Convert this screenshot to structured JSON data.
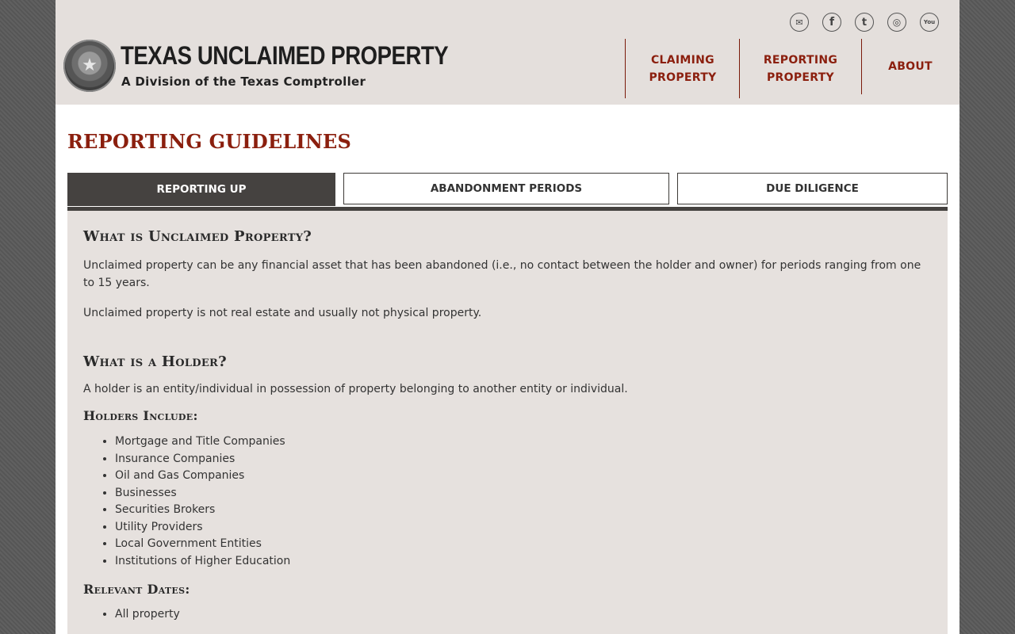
{
  "header": {
    "logo_title": "TEXAS UNCLAIMED PROPERTY",
    "logo_subtitle": "A Division of the Texas Comptroller",
    "social": [
      {
        "icon": "email-icon",
        "glyph": "✉"
      },
      {
        "icon": "facebook-icon",
        "glyph": "f"
      },
      {
        "icon": "twitter-icon",
        "glyph": "t"
      },
      {
        "icon": "instagram-icon",
        "glyph": "◎"
      },
      {
        "icon": "youtube-icon",
        "glyph": "You"
      }
    ],
    "nav": {
      "claiming_line1": "CLAIMING",
      "claiming_line2": "PROPERTY",
      "reporting_line1": "REPORTING",
      "reporting_line2": "PROPERTY",
      "about": "ABOUT"
    }
  },
  "main": {
    "title": "REPORTING GUIDELINES",
    "tabs": [
      {
        "label": "REPORTING UP",
        "active": true
      },
      {
        "label": "ABANDONMENT PERIODS",
        "active": false
      },
      {
        "label": "DUE DILIGENCE",
        "active": false
      }
    ],
    "section1": {
      "heading": "What is Unclaimed Property?",
      "para1": "Unclaimed property can be any financial asset that has been abandoned (i.e., no contact between the holder and owner) for periods ranging from one to 15 years.",
      "para2": "Unclaimed property is not real estate and usually not physical property."
    },
    "section2": {
      "heading": "What is a Holder?",
      "para1": "A holder is an entity/individual in possession of property belonging to another entity or individual.",
      "holders_heading": "Holders Include:",
      "holders": [
        "Mortgage and Title Companies",
        "Insurance Companies",
        "Oil and Gas Companies",
        "Businesses",
        "Securities Brokers",
        "Utility Providers",
        "Local Government Entities",
        "Institutions of Higher Education"
      ],
      "dates_heading": "Relevant Dates:",
      "dates": [
        "All property"
      ]
    }
  },
  "colors": {
    "accent": "#8b1f0e",
    "header_bg": "#e4dfdc",
    "panel_bg": "#e6e1de",
    "tab_active": "#454240"
  }
}
